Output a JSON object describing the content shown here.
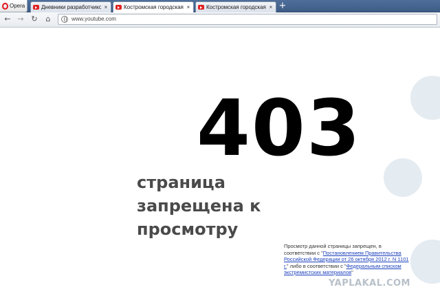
{
  "browser": {
    "menu_button_label": "Opera",
    "tabs": [
      {
        "label": "Дневники разработчиков",
        "active": false
      },
      {
        "label": "Костромская городская",
        "active": true
      },
      {
        "label": "Костромская городская",
        "active": false
      }
    ],
    "new_tab_symbol": "+",
    "tab_close_symbol": "×",
    "address": "www.youtube.com",
    "nav": {
      "back": "←",
      "forward": "→",
      "reload": "↻",
      "home": "⌂"
    }
  },
  "page": {
    "error_code": "403",
    "headline_lines": [
      "страница",
      "запрещена к",
      "просмотру"
    ],
    "note": {
      "text_1": "Просмотр данной страницы запрещен, в соответствии с \"",
      "link_1": "Постановлением Правительства Российской Федерации от 26 октября 2012 г. N 1101 г.",
      "text_2": "\" либо в соответствии с \"",
      "link_2": "Федеральным списком экстремистских материалов",
      "text_3": "\""
    },
    "watermark": "YAPLAKAL.COM"
  },
  "colors": {
    "tabbar": "#3d5c86",
    "circle": "#e4ebf1",
    "headline": "#4a4a4a",
    "link": "#1a3fbd"
  }
}
